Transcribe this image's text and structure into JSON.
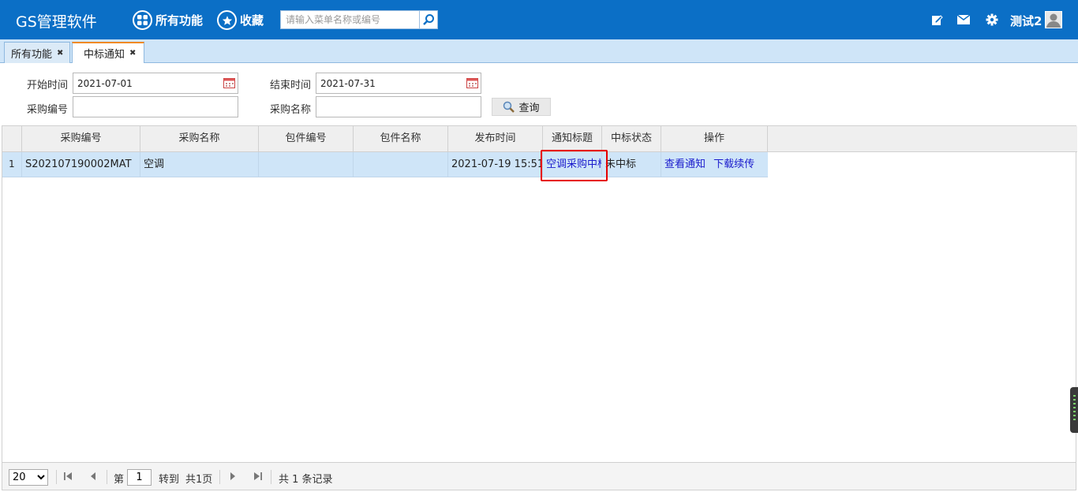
{
  "header": {
    "app_title": "GS管理软件",
    "nav_all": "所有功能",
    "nav_fav": "收藏",
    "search_placeholder": "请输入菜单名称或编号",
    "user_name": "测试2"
  },
  "tabs": [
    {
      "label": "所有功能",
      "active": false
    },
    {
      "label": "中标通知",
      "active": true
    }
  ],
  "form": {
    "start_label": "开始时间",
    "start_value": "2021-07-01",
    "end_label": "结束时间",
    "end_value": "2021-07-31",
    "code_label": "采购编号",
    "code_value": "",
    "name_label": "采购名称",
    "name_value": "",
    "query_label": "查询"
  },
  "table": {
    "columns": [
      "采购编号",
      "采购名称",
      "包件编号",
      "包件名称",
      "发布时间",
      "通知标题",
      "中标状态",
      "操作"
    ],
    "rows": [
      {
        "index": "1",
        "code": "S202107190002MAT",
        "name": "空调",
        "pkg_code": "",
        "pkg_name": "",
        "publish_time": "2021-07-19 15:51",
        "notice_title": "空调采购中标",
        "status": "未中标",
        "actions": [
          "查看通知",
          "下载续传"
        ]
      }
    ]
  },
  "pager": {
    "page_size": "20",
    "page_size_options": [
      "20"
    ],
    "page_prefix": "第",
    "page_value": "1",
    "goto_label": "转到",
    "total_pages": "共1页",
    "total_records": "共 1 条记录"
  },
  "colors": {
    "header_bg": "#0b6fc6",
    "tab_bar_bg": "#cfe5f8",
    "active_tab_accent": "#f08a24",
    "selected_row_bg": "#cfe5f8",
    "link": "#1a1acc",
    "highlight": "#e60000"
  }
}
